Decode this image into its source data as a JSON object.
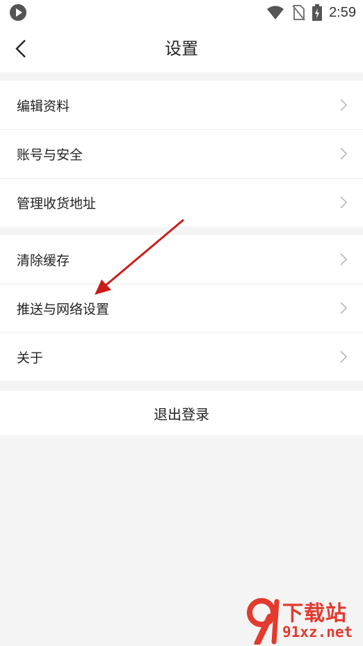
{
  "status_bar": {
    "time": "2:59",
    "icons": [
      "play-icon",
      "wifi-icon",
      "no-sim-icon",
      "battery-charging-icon"
    ]
  },
  "header": {
    "title": "设置",
    "back_icon": "chevron-left-icon"
  },
  "groups": [
    {
      "items": [
        {
          "label": "编辑资料"
        },
        {
          "label": "账号与安全"
        },
        {
          "label": "管理收货地址"
        }
      ]
    },
    {
      "items": [
        {
          "label": "清除缓存"
        },
        {
          "label": "推送与网络设置"
        },
        {
          "label": "关于"
        }
      ]
    }
  ],
  "logout": {
    "label": "退出登录"
  },
  "annotation": {
    "color": "#d0201c",
    "target": "推送与网络设置"
  },
  "watermark": {
    "title": "下载站",
    "url": "91xz.net",
    "color": "#e23a2e"
  }
}
